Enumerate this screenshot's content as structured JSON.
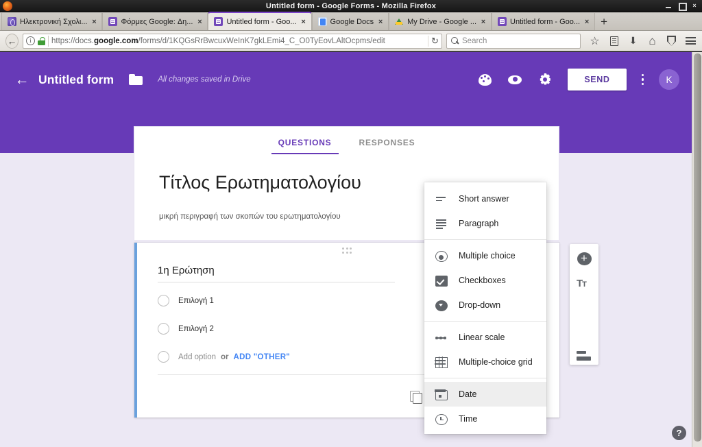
{
  "window": {
    "title": "Untitled form - Google Forms - Mozilla Firefox",
    "minimize_label": "",
    "maximize_label": "",
    "close_label": "×"
  },
  "browser": {
    "tabs": [
      {
        "label": "Ηλεκτρονική Σχολι...",
        "favicon": "globe-icon",
        "active": false,
        "close": "×"
      },
      {
        "label": "Φόρμες Google: Δη...",
        "favicon": "forms-icon",
        "active": false,
        "close": "×"
      },
      {
        "label": "Untitled form - Goo...",
        "favicon": "forms-icon",
        "active": true,
        "close": "×"
      },
      {
        "label": "Google Docs",
        "favicon": "docs-icon",
        "active": false,
        "close": "×"
      },
      {
        "label": "My Drive - Google ...",
        "favicon": "drive-icon",
        "active": false,
        "close": "×"
      },
      {
        "label": "Untitled form - Goo...",
        "favicon": "forms-icon",
        "active": false,
        "close": "×"
      }
    ],
    "new_tab_label": "+",
    "back_label": "←",
    "url_prefix": "https://docs.",
    "url_domain": "google.com",
    "url_path": "/forms/d/1KQGsRrBwcuxWeInK7gkLEmi4_C_O0TyEovLAltOcpms/edit",
    "reload_label": "↻",
    "search_placeholder": "Search",
    "identity_icon": "i",
    "nav_icons": [
      "star-icon",
      "reader-icon",
      "download-icon",
      "home-icon",
      "shield-icon",
      "hamburger-menu-icon"
    ]
  },
  "forms_header": {
    "back_label": "←",
    "doc_title": "Untitled form",
    "folder_icon": "folder-icon",
    "save_status": "All changes saved in Drive",
    "theme_icon": "palette-icon",
    "preview_icon": "eye-icon",
    "settings_icon": "gear-icon",
    "send_label": "SEND",
    "more_icon": "kebab-menu-icon",
    "avatar_initial": "K",
    "accent_color": "#673AB7"
  },
  "form_tabs": [
    {
      "label": "QUESTIONS",
      "selected": true
    },
    {
      "label": "RESPONSES",
      "selected": false
    }
  ],
  "form": {
    "title": "Τίτλος Ερωτηματολογίου",
    "description": "μικρή περιγραφή των σκοπών του ερωτηματολογίου"
  },
  "question": {
    "title": "1η Ερώτηση",
    "options": [
      {
        "label": "Επιλογή 1"
      },
      {
        "label": "Επιλογή 2"
      }
    ],
    "add_option_label": "Add option",
    "or_label": "or",
    "add_other_label": "ADD \"OTHER\"",
    "duplicate_icon": "duplicate-icon",
    "drag_icon": "drag-handle-icon",
    "selected_border_color": "#6aa1dd"
  },
  "side_toolbar": [
    {
      "icon": "add-question-icon",
      "name": "add-question"
    },
    {
      "icon": "title-text-icon",
      "name": "add-title"
    },
    {
      "icon": "image-icon",
      "name": "add-image"
    },
    {
      "icon": "video-icon",
      "name": "add-video"
    },
    {
      "icon": "section-icon",
      "name": "add-section"
    }
  ],
  "type_menu": {
    "groups": [
      {
        "items": [
          {
            "label": "Short answer",
            "icon": "short-answer-icon",
            "highlighted": false
          },
          {
            "label": "Paragraph",
            "icon": "paragraph-icon",
            "highlighted": false
          }
        ]
      },
      {
        "items": [
          {
            "label": "Multiple choice",
            "icon": "radio-icon",
            "highlighted": false
          },
          {
            "label": "Checkboxes",
            "icon": "checkbox-icon",
            "highlighted": false
          },
          {
            "label": "Drop-down",
            "icon": "dropdown-icon",
            "highlighted": false
          }
        ]
      },
      {
        "items": [
          {
            "label": "Linear scale",
            "icon": "linear-scale-icon",
            "highlighted": false
          },
          {
            "label": "Multiple-choice grid",
            "icon": "grid-icon",
            "highlighted": false
          }
        ]
      },
      {
        "items": [
          {
            "label": "Date",
            "icon": "calendar-icon",
            "highlighted": true
          },
          {
            "label": "Time",
            "icon": "clock-icon",
            "highlighted": false
          }
        ]
      }
    ]
  },
  "help": {
    "label": "?"
  }
}
